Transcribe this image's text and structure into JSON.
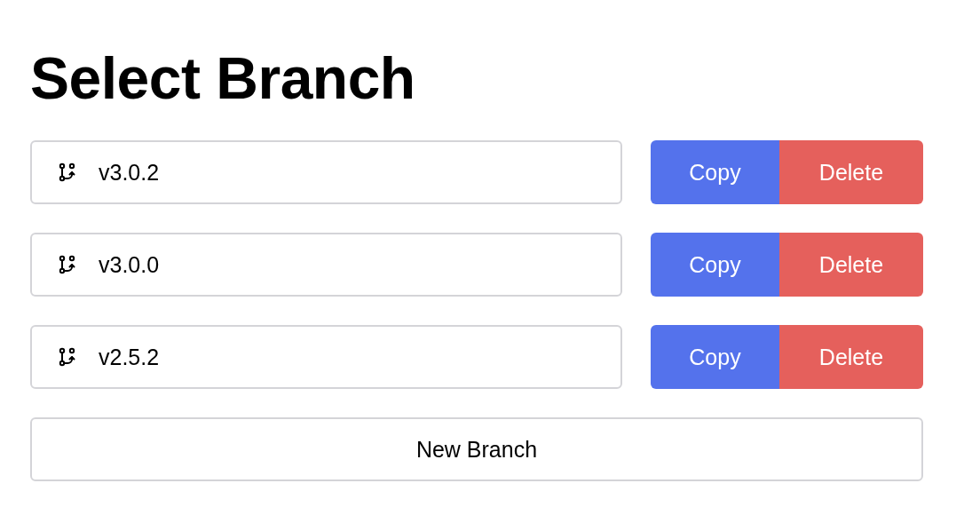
{
  "title": "Select Branch",
  "branches": [
    {
      "name": "v3.0.2",
      "copy": "Copy",
      "delete": "Delete"
    },
    {
      "name": "v3.0.0",
      "copy": "Copy",
      "delete": "Delete"
    },
    {
      "name": "v2.5.2",
      "copy": "Copy",
      "delete": "Delete"
    }
  ],
  "new_button": "New Branch"
}
